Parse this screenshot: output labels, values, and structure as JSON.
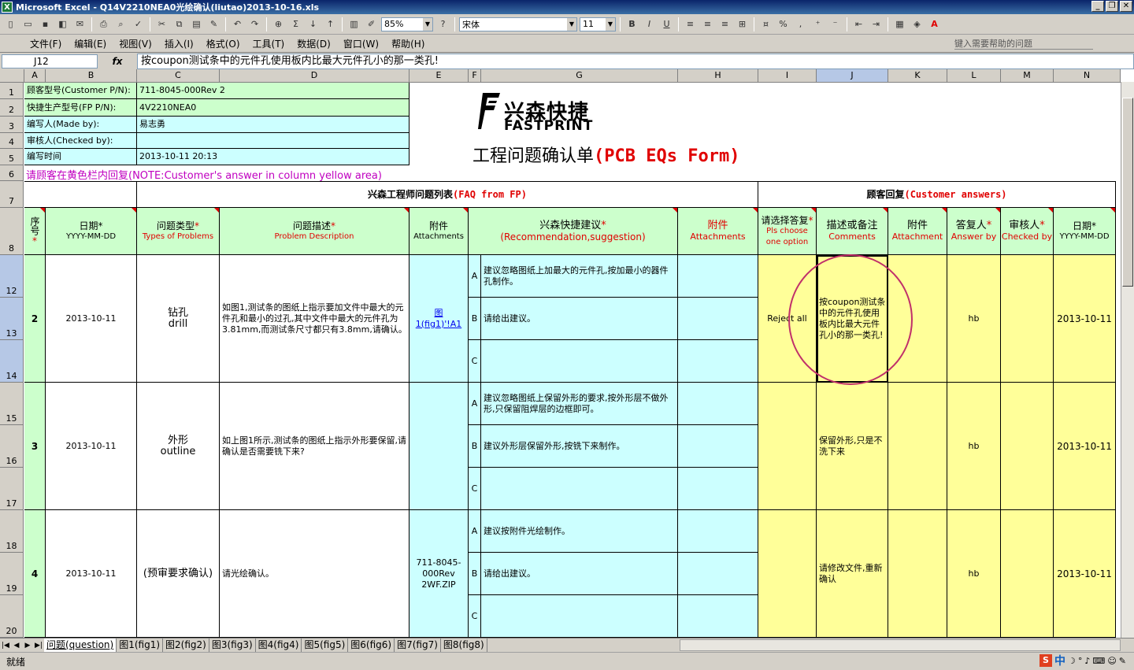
{
  "window": {
    "title": "Microsoft Excel - Q14V2210NEA0光绘确认(liutao)2013-10-16.xls",
    "app_icon": "X"
  },
  "toolbar": {
    "zoom": "85%",
    "font": "宋体",
    "size": "11"
  },
  "menus": [
    "文件(F)",
    "编辑(E)",
    "视图(V)",
    "插入(I)",
    "格式(O)",
    "工具(T)",
    "数据(D)",
    "窗口(W)",
    "帮助(H)"
  ],
  "help_placeholder": "键入需要帮助的问题",
  "formula_bar": {
    "name_box": "J12",
    "fx": "fx",
    "content": "按coupon测试条中的元件孔使用板内比最大元件孔小的那一类孔!"
  },
  "columns": [
    "A",
    "B",
    "C",
    "D",
    "E",
    "F",
    "G",
    "H",
    "I",
    "J",
    "K",
    "L",
    "M",
    "N"
  ],
  "rows": [
    "1",
    "2",
    "3",
    "4",
    "5",
    "6",
    "7",
    "8",
    "12",
    "13",
    "14",
    "15",
    "16",
    "17",
    "18",
    "19",
    "20"
  ],
  "info": {
    "customer_pn_label": "顾客型号(Customer P/N):",
    "customer_pn": "711-8045-000Rev 2",
    "fp_pn_label": "快捷生产型号(FP P/N):",
    "fp_pn": "4V2210NEA0",
    "made_by_label": "编写人(Made by):",
    "made_by": "易志勇",
    "checked_by_label": "审核人(Checked by):",
    "time_label": "编写时间",
    "time": "2013-10-11 20:13",
    "note": "请顾客在黄色栏内回复(NOTE:Customer's answer in column yellow area)"
  },
  "logo": {
    "cn": "兴森快捷",
    "en": "FASTPRINT"
  },
  "form_title": {
    "cn": "工程问题确认单",
    "en": "(PCB EQs Form)"
  },
  "section_fp": {
    "cn": "兴森工程师问题列表",
    "en": "(FAQ from FP)"
  },
  "section_cust": {
    "cn": "顾客回复",
    "en": "(Customer answers)"
  },
  "headers": {
    "seq": "序号",
    "date": "日期",
    "date_fmt": "YYYY-MM-DD",
    "type": "问题类型",
    "type_en": "Types of Problems",
    "desc": "问题描述",
    "desc_en": "Problem Description",
    "attach": "附件",
    "attach_en": "Attachments",
    "rec": "兴森快捷建议",
    "rec_en": "(Recommendation,suggestion)",
    "attach2": "附件",
    "attach2_en": "Attachments",
    "choose": "请选择答复",
    "choose_en": "Pls choose one option",
    "comments": "描述或备注",
    "comments_en": "Comments",
    "attach3": "附件",
    "attach3_en": "Attachment",
    "answer": "答复人",
    "answer_en": "Answer by",
    "checker": "审核人",
    "checker_en": "Checked by",
    "date2": "日期",
    "date2_fmt": "YYYY-MM-DD"
  },
  "items": [
    {
      "seq": "2",
      "date": "2013-10-11",
      "type_cn": "钻孔",
      "type_en": "drill",
      "desc": "如图1,测试条的图纸上指示要加文件中最大的元件孔和最小的过孔,其中文件中最大的元件孔为3.81mm,而测试条尺寸都只有3.8mm,请确认。",
      "attach": "图1(fig1)'!A1",
      "opts": [
        {
          "k": "A",
          "t": "建议忽略图纸上加最大的元件孔,按加最小的器件孔制作。"
        },
        {
          "k": "B",
          "t": "请给出建议。"
        },
        {
          "k": "C",
          "t": ""
        }
      ],
      "choice": "Reject all",
      "comment": "按coupon测试条中的元件孔使用板内比最大元件孔小的那一类孔!",
      "answer_by": "hb",
      "date2": "2013-10-11"
    },
    {
      "seq": "3",
      "date": "2013-10-11",
      "type_cn": "外形",
      "type_en": "outline",
      "desc": "如上图1所示,测试条的图纸上指示外形要保留,请确认是否需要铣下来?",
      "attach": "",
      "opts": [
        {
          "k": "A",
          "t": "建议忽略图纸上保留外形的要求,按外形层不做外形,只保留阻焊层的边框即可。"
        },
        {
          "k": "B",
          "t": "建议外形层保留外形,按铣下来制作。"
        },
        {
          "k": "C",
          "t": ""
        }
      ],
      "choice": "",
      "comment": "保留外形,只是不洗下来",
      "answer_by": "hb",
      "date2": "2013-10-11"
    },
    {
      "seq": "4",
      "date": "2013-10-11",
      "type_cn": "(预审要求确认)",
      "type_en": "",
      "desc": "请光绘确认。",
      "attach": "711-8045-000Rev 2WF.ZIP",
      "opts": [
        {
          "k": "A",
          "t": "建议按附件光绘制作。"
        },
        {
          "k": "B",
          "t": "请给出建议。"
        },
        {
          "k": "C",
          "t": ""
        }
      ],
      "choice": "",
      "comment": "请修改文件,重新确认",
      "answer_by": "hb",
      "date2": "2013-10-11"
    }
  ],
  "sheet_tabs": [
    "问题(question)",
    "图1(fig1)",
    "图2(fig2)",
    "图3(fig3)",
    "图4(fig4)",
    "图5(fig5)",
    "图6(fig6)",
    "图7(fig7)",
    "图8(fig8)"
  ],
  "status": "就绪",
  "colors": {
    "green": "#ccffcc",
    "cyan": "#ccffff",
    "yellow": "#ffff99",
    "red": "#e00000",
    "circle": "#c0306a"
  }
}
